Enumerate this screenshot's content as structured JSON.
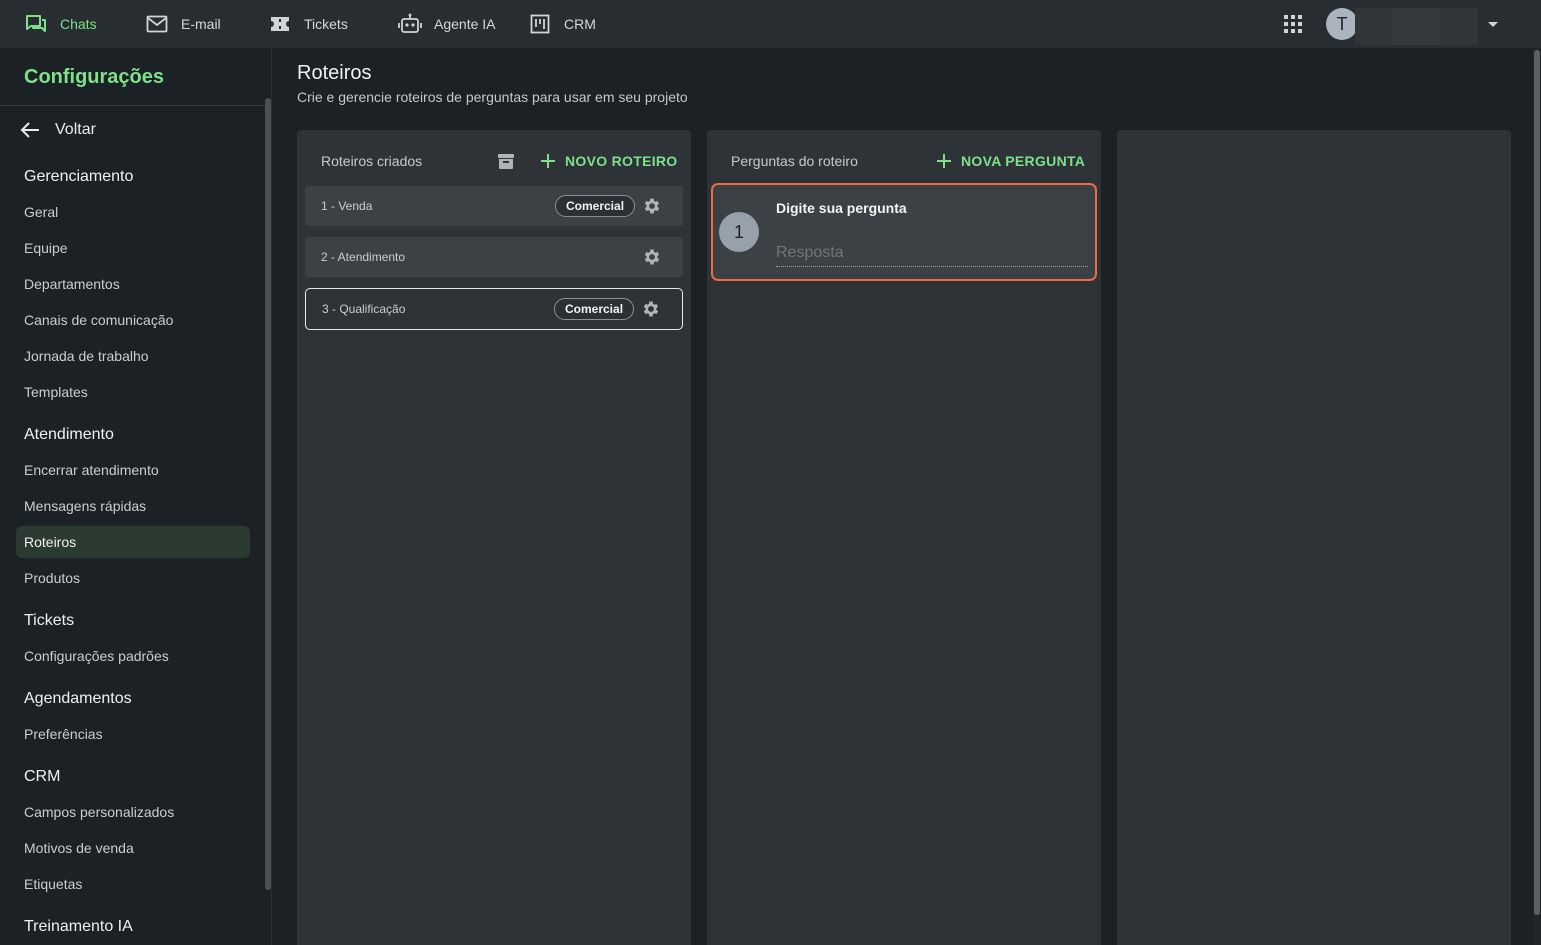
{
  "topnav": {
    "items": [
      {
        "label": "Chats",
        "icon": "chat-icon",
        "active": true
      },
      {
        "label": "E-mail",
        "icon": "mail-icon"
      },
      {
        "label": "Tickets",
        "icon": "ticket-icon"
      },
      {
        "label": "Agente IA",
        "icon": "robot-icon"
      },
      {
        "label": "CRM",
        "icon": "kanban-icon"
      }
    ],
    "user_initial": "T"
  },
  "sidebar": {
    "title": "Configurações",
    "back_label": "Voltar",
    "sections": [
      {
        "title": "Gerenciamento",
        "items": [
          "Geral",
          "Equipe",
          "Departamentos",
          "Canais de comunicação",
          "Jornada de trabalho",
          "Templates"
        ]
      },
      {
        "title": "Atendimento",
        "items": [
          "Encerrar atendimento",
          "Mensagens rápidas",
          "Roteiros",
          "Produtos"
        ]
      },
      {
        "title": "Tickets",
        "items": [
          "Configurações padrões"
        ]
      },
      {
        "title": "Agendamentos",
        "items": [
          "Preferências"
        ]
      },
      {
        "title": "CRM",
        "items": [
          "Campos personalizados",
          "Motivos de venda",
          "Etiquetas"
        ]
      },
      {
        "title": "Treinamento IA",
        "items": []
      }
    ],
    "active_item": "Roteiros"
  },
  "page": {
    "title": "Roteiros",
    "subtitle": "Crie e gerencie roteiros de perguntas para usar em seu projeto"
  },
  "scripts_panel": {
    "header": "Roteiros criados",
    "new_button": "NOVO ROTEIRO",
    "scripts": [
      {
        "label": "1 - Venda",
        "tag": "Comercial"
      },
      {
        "label": "2 - Atendimento",
        "tag": ""
      },
      {
        "label": "3 - Qualificação",
        "tag": "Comercial",
        "selected": true
      }
    ]
  },
  "questions_panel": {
    "header": "Perguntas do roteiro",
    "new_button": "NOVA PERGUNTA",
    "questions": [
      {
        "number": "1",
        "title": "Digite sua pergunta",
        "answer_placeholder": "Resposta"
      }
    ]
  },
  "colors": {
    "accent": "#7ee08a",
    "focus_border": "#ef6b3d",
    "panel": "#2d3336",
    "background": "#1b2124"
  }
}
